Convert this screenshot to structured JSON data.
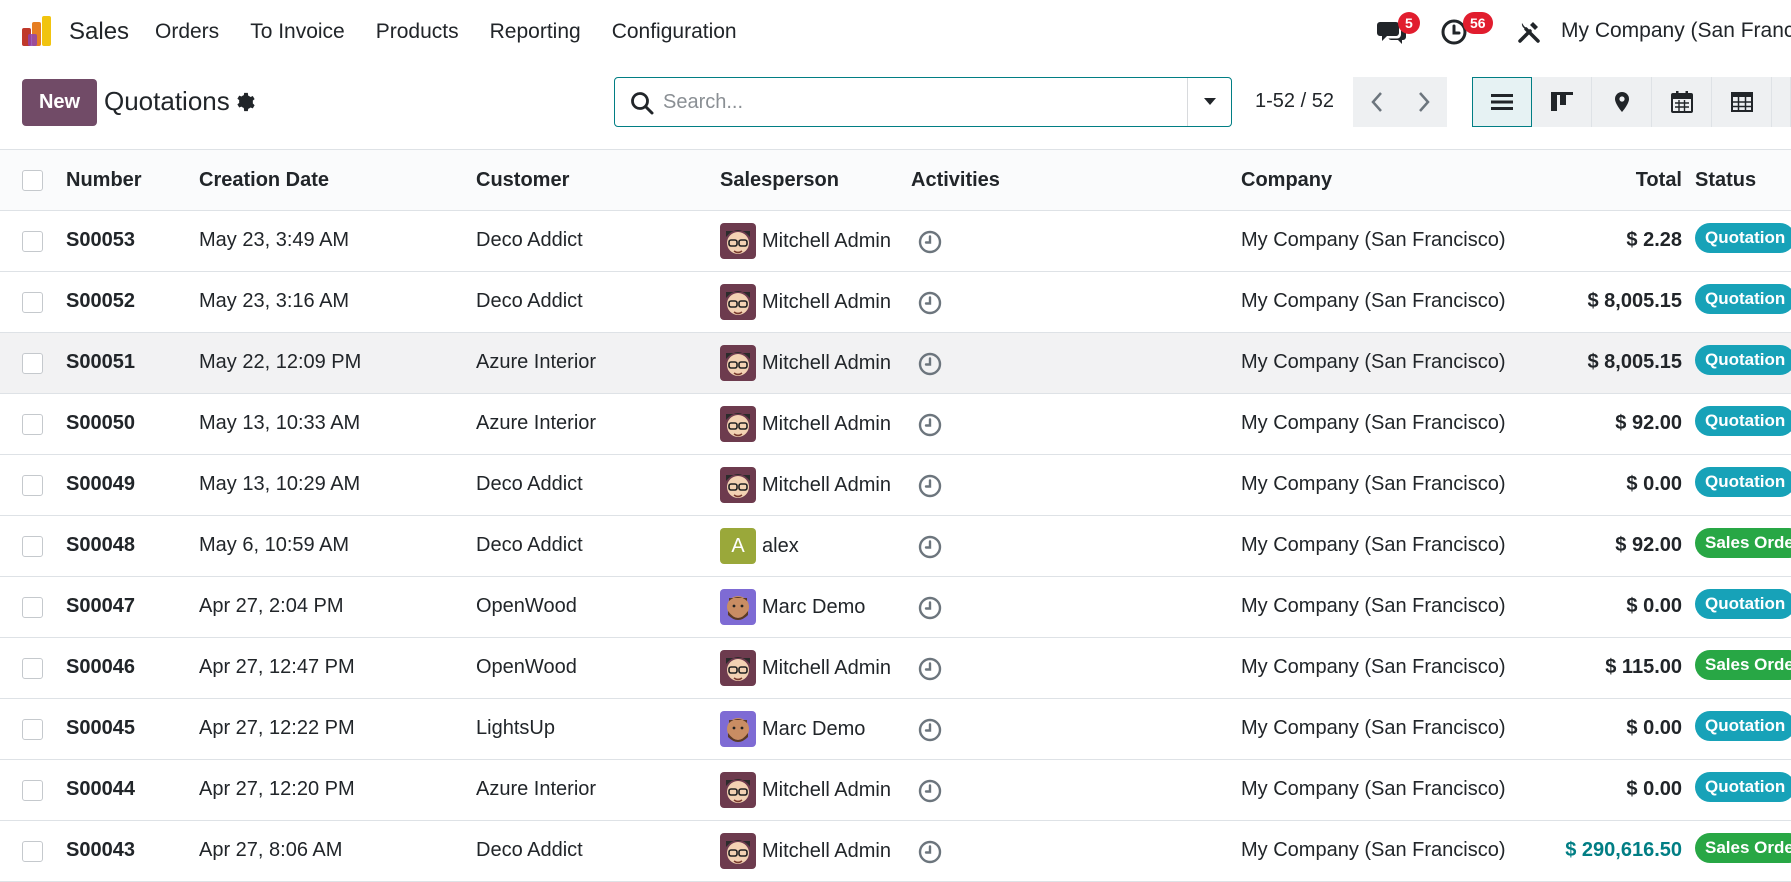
{
  "app": {
    "name": "Sales"
  },
  "menu": [
    "Orders",
    "To Invoice",
    "Products",
    "Reporting",
    "Configuration"
  ],
  "systray": {
    "messages_count": "5",
    "activities_count": "56",
    "company": "My Company (San Francisco)"
  },
  "control": {
    "new_label": "New",
    "title": "Quotations",
    "search_placeholder": "Search...",
    "pager": "1-52 / 52"
  },
  "colors": {
    "brand": "#714b67",
    "accent": "#017e84",
    "quotation": "#17a2b8",
    "sales_order": "#28a745"
  },
  "columns": [
    "Number",
    "Creation Date",
    "Customer",
    "Salesperson",
    "Activities",
    "Company",
    "Total",
    "Status"
  ],
  "rows": [
    {
      "number": "S00053",
      "date": "May 23, 3:49 AM",
      "customer": "Deco Addict",
      "salesperson": "Mitchell Admin",
      "avatar": "mitchell",
      "company": "My Company (San Francisco)",
      "total": "$ 2.28",
      "status": "Quotation",
      "status_type": "quotation"
    },
    {
      "number": "S00052",
      "date": "May 23, 3:16 AM",
      "customer": "Deco Addict",
      "salesperson": "Mitchell Admin",
      "avatar": "mitchell",
      "company": "My Company (San Francisco)",
      "total": "$ 8,005.15",
      "status": "Quotation",
      "status_type": "quotation"
    },
    {
      "number": "S00051",
      "date": "May 22, 12:09 PM",
      "customer": "Azure Interior",
      "salesperson": "Mitchell Admin",
      "avatar": "mitchell",
      "company": "My Company (San Francisco)",
      "total": "$ 8,005.15",
      "status": "Quotation",
      "status_type": "quotation"
    },
    {
      "number": "S00050",
      "date": "May 13, 10:33 AM",
      "customer": "Azure Interior",
      "salesperson": "Mitchell Admin",
      "avatar": "mitchell",
      "company": "My Company (San Francisco)",
      "total": "$ 92.00",
      "status": "Quotation",
      "status_type": "quotation"
    },
    {
      "number": "S00049",
      "date": "May 13, 10:29 AM",
      "customer": "Deco Addict",
      "salesperson": "Mitchell Admin",
      "avatar": "mitchell",
      "company": "My Company (San Francisco)",
      "total": "$ 0.00",
      "status": "Quotation",
      "status_type": "quotation"
    },
    {
      "number": "S00048",
      "date": "May 6, 10:59 AM",
      "customer": "Deco Addict",
      "salesperson": "alex",
      "avatar": "letter-a",
      "company": "My Company (San Francisco)",
      "total": "$ 92.00",
      "status": "Sales Orde",
      "status_type": "sales_order"
    },
    {
      "number": "S00047",
      "date": "Apr 27, 2:04 PM",
      "customer": "OpenWood",
      "salesperson": "Marc Demo",
      "avatar": "marc",
      "company": "My Company (San Francisco)",
      "total": "$ 0.00",
      "status": "Quotation",
      "status_type": "quotation"
    },
    {
      "number": "S00046",
      "date": "Apr 27, 12:47 PM",
      "customer": "OpenWood",
      "salesperson": "Mitchell Admin",
      "avatar": "mitchell",
      "company": "My Company (San Francisco)",
      "total": "$ 115.00",
      "status": "Sales Orde",
      "status_type": "sales_order"
    },
    {
      "number": "S00045",
      "date": "Apr 27, 12:22 PM",
      "customer": "LightsUp",
      "salesperson": "Marc Demo",
      "avatar": "marc",
      "company": "My Company (San Francisco)",
      "total": "$ 0.00",
      "status": "Quotation",
      "status_type": "quotation"
    },
    {
      "number": "S00044",
      "date": "Apr 27, 12:20 PM",
      "customer": "Azure Interior",
      "salesperson": "Mitchell Admin",
      "avatar": "mitchell",
      "company": "My Company (San Francisco)",
      "total": "$ 0.00",
      "status": "Quotation",
      "status_type": "quotation"
    },
    {
      "number": "S00043",
      "date": "Apr 27, 8:06 AM",
      "customer": "Deco Addict",
      "salesperson": "Mitchell Admin",
      "avatar": "mitchell",
      "company": "My Company (San Francisco)",
      "total": "$ 290,616.50",
      "status": "Sales Orde",
      "status_type": "sales_order",
      "total_highlight": true
    }
  ]
}
